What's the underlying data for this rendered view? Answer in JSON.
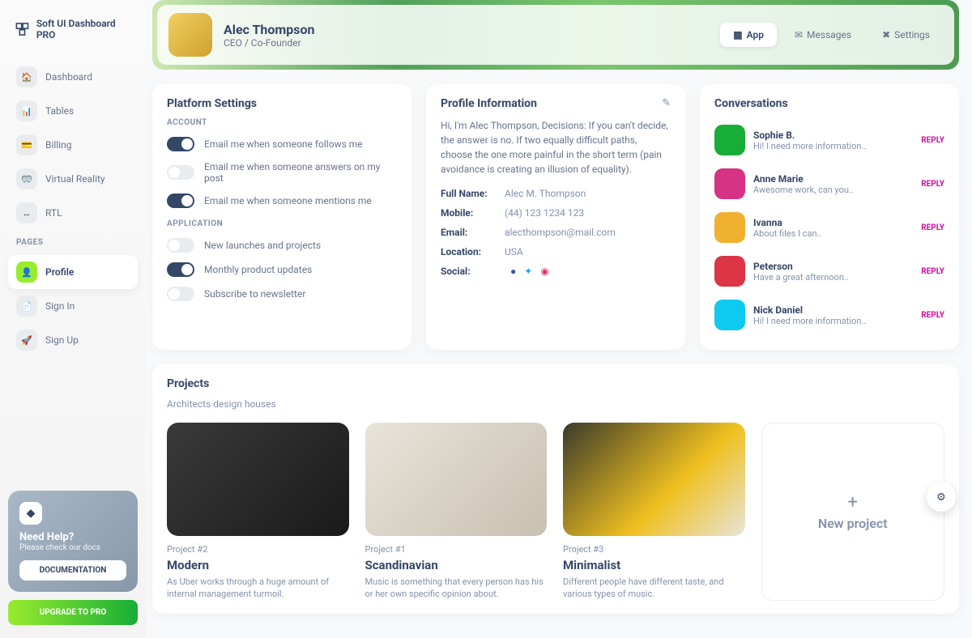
{
  "brand": "Soft UI Dashboard PRO",
  "nav": [
    {
      "icon": "🏠",
      "label": "Dashboard"
    },
    {
      "icon": "📊",
      "label": "Tables"
    },
    {
      "icon": "💳",
      "label": "Billing"
    },
    {
      "icon": "🥽",
      "label": "Virtual Reality"
    },
    {
      "icon": "↔",
      "label": "RTL"
    }
  ],
  "pagesLabel": "PAGES",
  "pages": [
    {
      "icon": "👤",
      "label": "Profile",
      "active": true
    },
    {
      "icon": "📄",
      "label": "Sign In"
    },
    {
      "icon": "🚀",
      "label": "Sign Up"
    }
  ],
  "help": {
    "title": "Need Help?",
    "sub": "Please check our docs",
    "doc": "DOCUMENTATION"
  },
  "upgrade": "UPGRADE TO PRO",
  "header": {
    "name": "Alec Thompson",
    "role": "CEO / Co-Founder"
  },
  "tabs": [
    {
      "label": "App",
      "active": true
    },
    {
      "label": "Messages"
    },
    {
      "label": "Settings"
    }
  ],
  "platform": {
    "title": "Platform Settings",
    "account": "ACCOUNT",
    "items1": [
      {
        "on": true,
        "label": "Email me when someone follows me"
      },
      {
        "on": false,
        "label": "Email me when someone answers on my post"
      },
      {
        "on": true,
        "label": "Email me when someone mentions me"
      }
    ],
    "app": "APPLICATION",
    "items2": [
      {
        "on": false,
        "label": "New launches and projects"
      },
      {
        "on": true,
        "label": "Monthly product updates"
      },
      {
        "on": false,
        "label": "Subscribe to newsletter"
      }
    ]
  },
  "profile": {
    "title": "Profile Information",
    "bio": "Hi, I'm Alec Thompson, Decisions: If you can't decide, the answer is no. If two equally difficult paths, choose the one more painful in the short term (pain avoidance is creating an illusion of equality).",
    "fields": {
      "fullNameLabel": "Full Name:",
      "fullName": "Alec M. Thompson",
      "mobileLabel": "Mobile:",
      "mobile": "(44) 123 1234 123",
      "emailLabel": "Email:",
      "email": "alecthompson@mail.com",
      "locationLabel": "Location:",
      "location": "USA",
      "socialLabel": "Social:"
    }
  },
  "conversations": {
    "title": "Conversations",
    "reply": "REPLY",
    "items": [
      {
        "name": "Sophie B.",
        "sub": "Hi! I need more information..",
        "c": "#17ad37"
      },
      {
        "name": "Anne Marie",
        "sub": "Awesome work, can you..",
        "c": "#d63384"
      },
      {
        "name": "Ivanna",
        "sub": "About files I can..",
        "c": "#f0b030"
      },
      {
        "name": "Peterson",
        "sub": "Have a great afternoon..",
        "c": "#dc3545"
      },
      {
        "name": "Nick Daniel",
        "sub": "Hi! I need more information..",
        "c": "#0dcaf0"
      }
    ]
  },
  "projects": {
    "title": "Projects",
    "sub": "Architects design houses",
    "items": [
      {
        "tag": "Project #2",
        "title": "Modern",
        "desc": "As Uber works through a huge amount of internal management turmoil.",
        "bg": "linear-gradient(135deg,#3a3a3a,#1a1a1a)"
      },
      {
        "tag": "Project #1",
        "title": "Scandinavian",
        "desc": "Music is something that every person has his or her own specific opinion about.",
        "bg": "linear-gradient(135deg,#e8e4da,#c8c0b0)"
      },
      {
        "tag": "Project #3",
        "title": "Minimalist",
        "desc": "Different people have different taste, and various types of music.",
        "bg": "linear-gradient(135deg,#3a3a2a,#f0c020 60%,#e8e4da)"
      }
    ],
    "new": "New project"
  }
}
